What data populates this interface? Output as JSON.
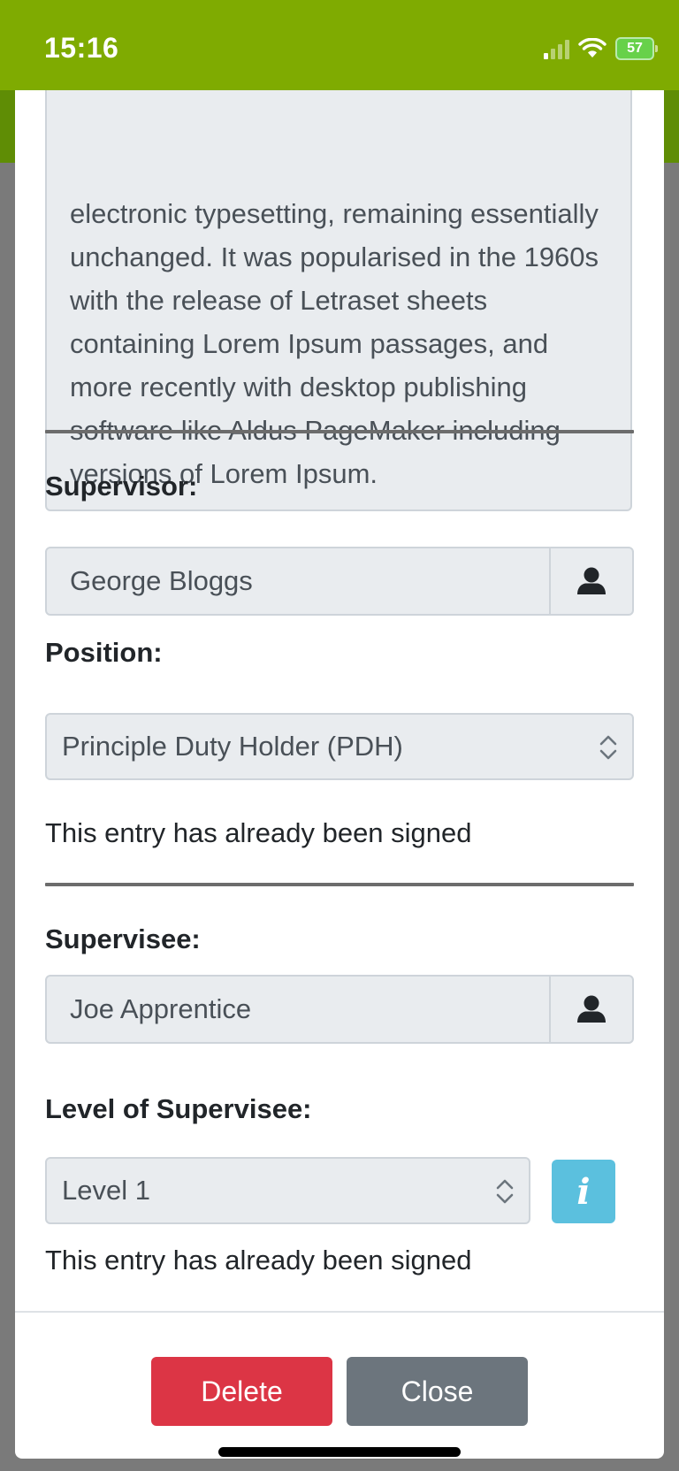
{
  "status_bar": {
    "time": "15:16",
    "battery": "57"
  },
  "description": {
    "text": "electronic typesetting, remaining essentially unchanged. It was popularised in the 1960s with the release of Letraset sheets containing Lorem Ipsum passages, and more recently with desktop publishing software like Aldus PageMaker including versions of Lorem Ipsum."
  },
  "supervisor": {
    "label": "Supervisor:",
    "value": "George Bloggs",
    "icon": "user-icon"
  },
  "position": {
    "label": "Position:",
    "selected": "Principle Duty Holder (PDH)",
    "note": "This entry has already been signed"
  },
  "supervisee": {
    "label": "Supervisee:",
    "value": "Joe Apprentice",
    "icon": "user-icon"
  },
  "level": {
    "label": "Level of Supervisee:",
    "selected": "Level 1",
    "info_icon": "i",
    "note": "This entry has already been signed"
  },
  "footer": {
    "delete_label": "Delete",
    "close_label": "Close"
  },
  "colors": {
    "status_bar": "#7fab01",
    "delete": "#dc3545",
    "close": "#6c757d",
    "info": "#5bc0de"
  }
}
